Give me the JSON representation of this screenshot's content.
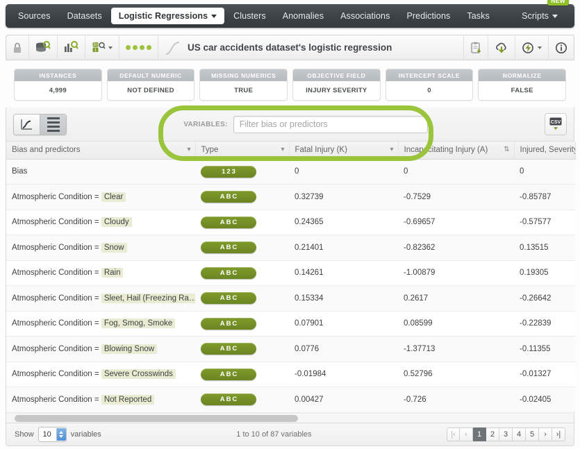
{
  "nav": {
    "items": [
      {
        "label": "Sources",
        "active": false,
        "caret": false
      },
      {
        "label": "Datasets",
        "active": false,
        "caret": false
      },
      {
        "label": "Logistic Regressions",
        "active": true,
        "caret": true
      },
      {
        "label": "Clusters",
        "active": false,
        "caret": false
      },
      {
        "label": "Anomalies",
        "active": false,
        "caret": false
      },
      {
        "label": "Associations",
        "active": false,
        "caret": false
      },
      {
        "label": "Predictions",
        "active": false,
        "caret": false
      },
      {
        "label": "Tasks",
        "active": false,
        "caret": false
      }
    ],
    "right": {
      "label": "Scripts",
      "badge": "NEW"
    }
  },
  "toolbar": {
    "title": "US car accidents dataset's logistic regression",
    "icons": {
      "lock": "lock-icon",
      "dataset_search": "dataset-search-icon",
      "model_search": "model-search-icon",
      "fields_search": "fields-search-icon",
      "dots": "status-dots",
      "curve": "sigmoid-curve-icon",
      "clipboard": "clipboard-download-icon",
      "cloud": "cloud-download-icon",
      "flash": "flash-actions-icon",
      "info": "info-icon"
    }
  },
  "cards": [
    {
      "title": "INSTANCES",
      "value": "4,999",
      "has_icon": true
    },
    {
      "title": "DEFAULT NUMERIC",
      "value": "NOT DEFINED",
      "has_icon": false
    },
    {
      "title": "MISSING NUMERICS",
      "value": "TRUE",
      "has_icon": false
    },
    {
      "title": "OBJECTIVE FIELD",
      "value": "INJURY SEVERITY",
      "has_icon": false
    },
    {
      "title": "INTERCEPT SCALE",
      "value": "0",
      "has_icon": false
    },
    {
      "title": "NORMALIZE",
      "value": "FALSE",
      "has_icon": false
    }
  ],
  "filterbar": {
    "variables_label": "VARIABLES:",
    "filter_placeholder": "Filter bias or predictors",
    "filter_value": "",
    "csv_label": "CSV",
    "view_chart_icon": "chart-view-icon",
    "view_table_icon": "table-view-icon"
  },
  "table": {
    "columns": [
      {
        "label": "Bias and predictors",
        "sort": "desc"
      },
      {
        "label": "Type",
        "sort": "desc"
      },
      {
        "label": "Fatal Injury (K)",
        "sort": "desc"
      },
      {
        "label": "Incapacitating Injury (A)",
        "sort": "both"
      },
      {
        "label": "Injured, Severity",
        "sort": "none"
      }
    ],
    "rows": [
      {
        "predictor": "Bias",
        "value": "",
        "type": "123",
        "fatal": "0",
        "incapacitating": "0",
        "injured": "0"
      },
      {
        "predictor": "Atmospheric Condition = ",
        "value": "Clear",
        "type": "ABC",
        "fatal": "0.32739",
        "incapacitating": "-0.7529",
        "injured": "-0.85787"
      },
      {
        "predictor": "Atmospheric Condition = ",
        "value": "Cloudy",
        "type": "ABC",
        "fatal": "0.24365",
        "incapacitating": "-0.69657",
        "injured": "-0.57577"
      },
      {
        "predictor": "Atmospheric Condition = ",
        "value": "Snow",
        "type": "ABC",
        "fatal": "0.21401",
        "incapacitating": "-0.82362",
        "injured": "0.13515"
      },
      {
        "predictor": "Atmospheric Condition = ",
        "value": "Rain",
        "type": "ABC",
        "fatal": "0.14261",
        "incapacitating": "-1.00879",
        "injured": "0.19305"
      },
      {
        "predictor": "Atmospheric Condition = ",
        "value": "Sleet, Hail (Freezing Ra…",
        "type": "ABC",
        "fatal": "0.15334",
        "incapacitating": "0.2617",
        "injured": "-0.26642"
      },
      {
        "predictor": "Atmospheric Condition = ",
        "value": "Fog, Smog, Smoke",
        "type": "ABC",
        "fatal": "0.07901",
        "incapacitating": "0.08599",
        "injured": "-0.22839"
      },
      {
        "predictor": "Atmospheric Condition = ",
        "value": "Blowing Snow",
        "type": "ABC",
        "fatal": "0.0776",
        "incapacitating": "-1.37713",
        "injured": "-0.11355"
      },
      {
        "predictor": "Atmospheric Condition = ",
        "value": "Severe Crosswinds",
        "type": "ABC",
        "fatal": "-0.01984",
        "incapacitating": "0.52796",
        "injured": "-0.01327"
      },
      {
        "predictor": "Atmospheric Condition = ",
        "value": "Not Reported",
        "type": "ABC",
        "fatal": "0.00427",
        "incapacitating": "-0.726",
        "injured": "-0.02405"
      }
    ]
  },
  "footer": {
    "show_label": "Show",
    "show_value": "10",
    "variables_label": "variables",
    "range_text": "1 to 10 of 87 variables",
    "pages": [
      "1",
      "2",
      "3",
      "4",
      "5"
    ],
    "current_page": "1",
    "first_icon": "first-page-icon",
    "prev_icon": "prev-page-icon",
    "next_icon": "next-page-icon",
    "last_icon": "last-page-icon"
  },
  "colors": {
    "accent_green": "#9ac43b",
    "pill_green": "#7f9b2a",
    "nav_dark": "#3c4246"
  }
}
